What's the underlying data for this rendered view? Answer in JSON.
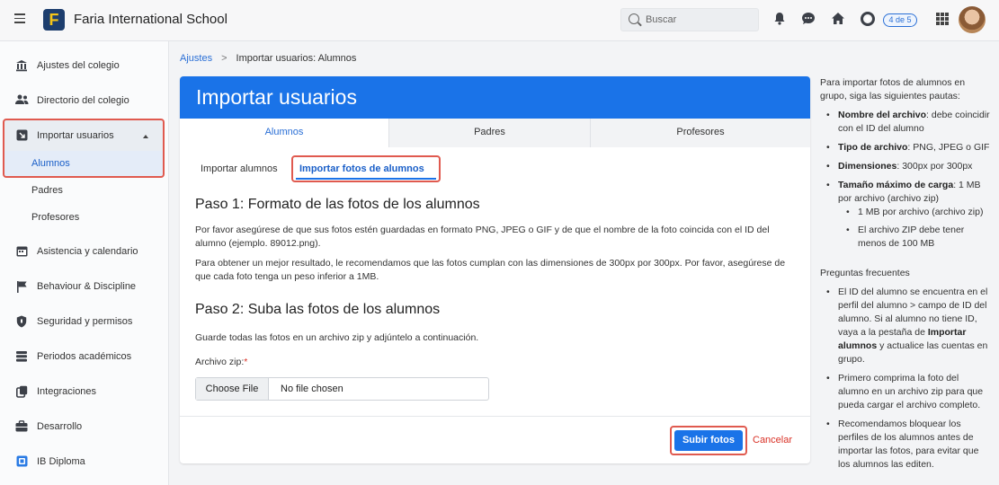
{
  "header": {
    "app_title": "Faria International School",
    "logo_letter": "F",
    "search_placeholder": "Buscar",
    "progress_badge": "4 de 5",
    "icons": [
      "hamburger-icon",
      "bell-icon",
      "chat-icon",
      "home-icon",
      "lifebuoy-icon",
      "apps-grid-icon",
      "avatar"
    ]
  },
  "sidebar": {
    "items": [
      {
        "label": "Ajustes del colegio",
        "icon": "bank-icon"
      },
      {
        "label": "Directorio del colegio",
        "icon": "people-icon"
      },
      {
        "label": "Importar usuarios",
        "icon": "import-icon"
      },
      {
        "label": "Asistencia y calendario",
        "icon": "calendar-icon"
      },
      {
        "label": "Behaviour & Discipline",
        "icon": "flag-icon"
      },
      {
        "label": "Seguridad y permisos",
        "icon": "shield-icon"
      },
      {
        "label": "Periodos académicos",
        "icon": "layers-icon"
      },
      {
        "label": "Integraciones",
        "icon": "copy-icon"
      },
      {
        "label": "Desarrollo",
        "icon": "briefcase-icon"
      },
      {
        "label": "IB Diploma",
        "icon": "ib-icon"
      }
    ],
    "subitems": [
      "Alumnos",
      "Padres",
      "Profesores"
    ]
  },
  "breadcrumb": {
    "parent": "Ajustes",
    "separator": ">",
    "current": "Importar usuarios: Alumnos"
  },
  "main": {
    "title": "Importar usuarios",
    "tabs": [
      "Alumnos",
      "Padres",
      "Profesores"
    ],
    "subtabs": [
      "Importar alumnos",
      "Importar fotos de alumnos"
    ],
    "step1_title": "Paso 1: Formato de las fotos de los alumnos",
    "step1_p1": "Por favor asegúrese de que sus fotos estén guardadas en formato PNG, JPEG o GIF y de que el nombre de la foto coincida con el ID del alumno (ejemplo. 89012.png).",
    "step1_p2": "Para obtener un mejor resultado, le recomendamos que las fotos cumplan con las dimensiones de 300px por 300px. Por favor, asegúrese de que cada foto tenga un peso inferior a 1MB.",
    "step2_title": "Paso 2: Suba las fotos de los alumnos",
    "step2_p1": "Guarde todas las fotos en un archivo zip y adjúntelo a continuación.",
    "file_label": "Archivo zip:",
    "required_mark": "*",
    "file_button": "Choose File",
    "file_value": "No file chosen",
    "submit_label": "Subir fotos",
    "cancel_label": "Cancelar"
  },
  "help": {
    "intro": "Para importar fotos de alumnos en grupo, siga las siguientes pautas:",
    "rules": [
      {
        "term": "Nombre del archivo",
        "text": ": debe coincidir con el ID del alumno"
      },
      {
        "term": "Tipo de archivo",
        "text": ": PNG, JPEG o GIF"
      },
      {
        "term": "Dimensiones",
        "text": ": 300px por 300px"
      },
      {
        "term": "Tamaño máximo de carga",
        "text": ": 1 MB por archivo (archivo zip)"
      }
    ],
    "subrules": [
      "1 MB por archivo (archivo zip)",
      "El archivo ZIP debe tener menos de 100 MB"
    ],
    "faq_title": "Preguntas frecuentes",
    "faq1_a": "El ID del alumno se encuentra en el perfil del alumno > campo de ID del alumno. Si al alumno no tiene ID, vaya a la pestaña de ",
    "faq1_b": "Importar alumnos",
    "faq1_c": " y actualice las cuentas en grupo.",
    "faq2": "Primero comprima la foto del alumno en un archivo zip para que pueda cargar el archivo completo.",
    "faq3": "Recomendamos bloquear los perfiles de los alumnos antes de importar las fotos, para evitar que los alumnos las editen."
  },
  "colors": {
    "accent": "#1a73e8",
    "highlight_outline": "#e05a4f",
    "cancel": "#d93025"
  }
}
